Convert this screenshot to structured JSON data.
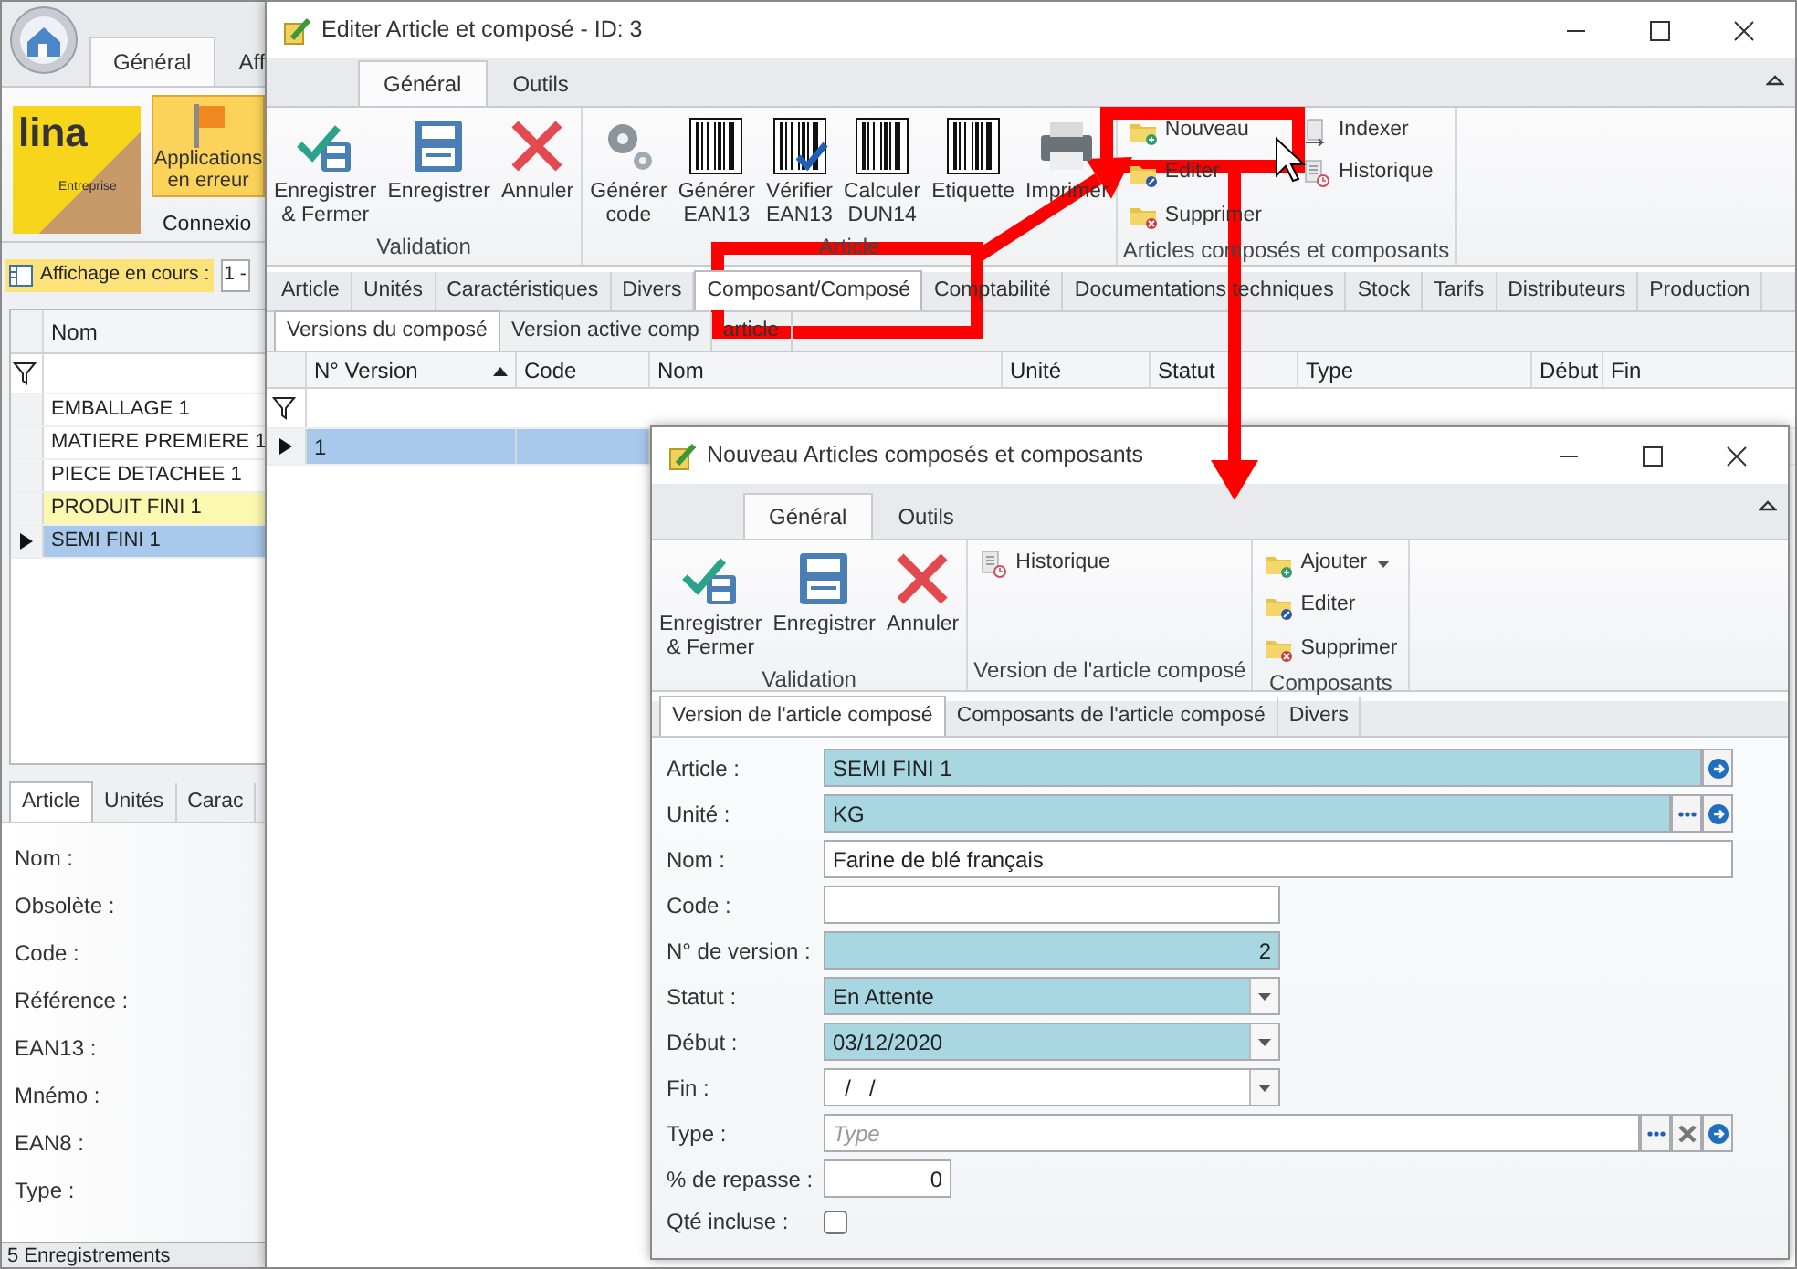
{
  "desktop_app": {
    "ribbon_tabs": [
      {
        "label": "Général",
        "selected": true
      },
      {
        "label": "Aff",
        "selected": false
      }
    ],
    "logo": {
      "text": "lina",
      "caption": "Entreprise"
    },
    "connection_button": {
      "label": "Applications\nen erreur",
      "highlighted": true
    },
    "connection_group": "Connexio",
    "view_label": "Affichage en cours :",
    "view_value": "1 -",
    "grid": {
      "column": "Nom",
      "rows": [
        {
          "name": "EMBALLAGE 1",
          "selected": false,
          "highlighted": false
        },
        {
          "name": "MATIERE PREMIERE 1",
          "selected": false,
          "highlighted": false
        },
        {
          "name": "PIECE DETACHEE 1",
          "selected": false,
          "highlighted": false
        },
        {
          "name": "PRODUIT FINI 1",
          "selected": false,
          "highlighted": true
        },
        {
          "name": "SEMI FINI 1",
          "selected": true,
          "highlighted": false
        }
      ]
    },
    "detail_tabs": [
      {
        "label": "Article",
        "selected": true
      },
      {
        "label": "Unités",
        "selected": false
      },
      {
        "label": "Carac",
        "selected": false
      }
    ],
    "detail_fields": [
      "Nom :",
      "Obsolète :",
      "Code :",
      "Référence :",
      "EAN13 :",
      "Mnémo :",
      "EAN8 :",
      "Type :"
    ],
    "status_bar": "5 Enregistrements"
  },
  "article_window": {
    "title": "Editer Article et composé - ID: 3",
    "ribbon_tabs": [
      {
        "label": "Général",
        "selected": true
      },
      {
        "label": "Outils",
        "selected": false
      }
    ],
    "groups": [
      {
        "label": "Validation",
        "kind": "large",
        "buttons": [
          {
            "label": "Enregistrer\n& Fermer"
          },
          {
            "label": "Enregistrer"
          },
          {
            "label": "Annuler"
          }
        ]
      },
      {
        "label": "Article",
        "kind": "large",
        "buttons": [
          {
            "label": "Générer\ncode"
          },
          {
            "label": "Générer\nEAN13"
          },
          {
            "label": "Vérifier\nEAN13"
          },
          {
            "label": "Calculer\nDUN14"
          },
          {
            "label": "Etiquette"
          },
          {
            "label": "Imprimer"
          }
        ]
      },
      {
        "label": "Articles composés et composants",
        "kind": "small",
        "buttons": [
          {
            "label": "Nouveau"
          },
          {
            "label": "Editer"
          },
          {
            "label": "Supprimer"
          },
          {
            "label": "Indexer"
          },
          {
            "label": "Historique"
          }
        ]
      }
    ],
    "tabs": [
      {
        "label": "Article",
        "selected": false
      },
      {
        "label": "Unités",
        "selected": false
      },
      {
        "label": "Caractéristiques",
        "selected": false
      },
      {
        "label": "Divers",
        "selected": false
      },
      {
        "label": "Composant/Composé",
        "selected": true
      },
      {
        "label": "Comptabilité",
        "selected": false
      },
      {
        "label": "Documentations techniques",
        "selected": false
      },
      {
        "label": "Stock",
        "selected": false
      },
      {
        "label": "Tarifs",
        "selected": false
      },
      {
        "label": "Distributeurs",
        "selected": false
      },
      {
        "label": "Production",
        "selected": false
      }
    ],
    "sub_tabs": [
      {
        "label": "Versions du composé",
        "selected": true
      },
      {
        "label": "Version active comp",
        "selected": false
      },
      {
        "label": "article",
        "selected": false
      }
    ],
    "grid": {
      "columns": [
        {
          "label": "N° Version",
          "sorted": true
        },
        {
          "label": "Code",
          "sorted": false
        },
        {
          "label": "Nom",
          "sorted": false
        },
        {
          "label": "Unité",
          "sorted": false
        },
        {
          "label": "Statut",
          "sorted": false
        },
        {
          "label": "Type",
          "sorted": false
        },
        {
          "label": "Début",
          "sorted": false
        },
        {
          "label": "Fin",
          "sorted": false
        }
      ],
      "rows": [
        {
          "cells": [
            "1"
          ],
          "selected": true
        }
      ]
    }
  },
  "composition_window": {
    "title": "Nouveau Articles composés et composants",
    "ribbon_tabs": [
      {
        "label": "Général",
        "selected": true
      },
      {
        "label": "Outils",
        "selected": false
      }
    ],
    "groups": [
      {
        "label": "Validation",
        "kind": "large",
        "buttons": [
          {
            "label": "Enregistrer\n& Fermer"
          },
          {
            "label": "Enregistrer"
          },
          {
            "label": "Annuler"
          }
        ]
      },
      {
        "label": "Version de l'article composé",
        "kind": "small",
        "buttons": [
          {
            "label": "Historique"
          }
        ]
      },
      {
        "label": "Composants",
        "kind": "small",
        "buttons": [
          {
            "label": "Ajouter",
            "dropdown": true
          },
          {
            "label": "Editer",
            "dropdown": false
          },
          {
            "label": "Supprimer",
            "dropdown": false
          }
        ]
      }
    ],
    "tabs": [
      {
        "label": "Version de l'article composé",
        "selected": true
      },
      {
        "label": "Composants de l'article composé",
        "selected": false
      },
      {
        "label": "Divers",
        "selected": false
      }
    ],
    "fields": [
      {
        "label": "Article :",
        "kind": "text",
        "value": "SEMI FINI 1",
        "required": true
      },
      {
        "label": "Unité :",
        "kind": "text",
        "value": "KG",
        "required": true
      },
      {
        "label": "Nom :",
        "kind": "text",
        "value": "Farine de blé français",
        "required": false
      },
      {
        "label": "Code :",
        "kind": "text",
        "required": false
      },
      {
        "label": "N° de version :",
        "kind": "number",
        "value": "2",
        "required": true
      },
      {
        "label": "Statut :",
        "kind": "combo",
        "value": "En Attente",
        "required": true
      },
      {
        "label": "Début :",
        "kind": "combo",
        "value": "03/12/2020",
        "required": true
      },
      {
        "label": "Fin :",
        "kind": "combo",
        "value": "  /   /",
        "required": false
      },
      {
        "label": "Type :",
        "kind": "text",
        "placeholder": "Type",
        "required": false
      },
      {
        "label": "% de repasse :",
        "kind": "number",
        "value": "0",
        "required": false
      },
      {
        "label": "Qté incluse :",
        "kind": "checkbox",
        "checked": false
      }
    ]
  },
  "annotations": [
    {
      "kind": "frame"
    },
    {
      "kind": "frame"
    },
    {
      "kind": "arrow"
    },
    {
      "kind": "arrow"
    }
  ]
}
